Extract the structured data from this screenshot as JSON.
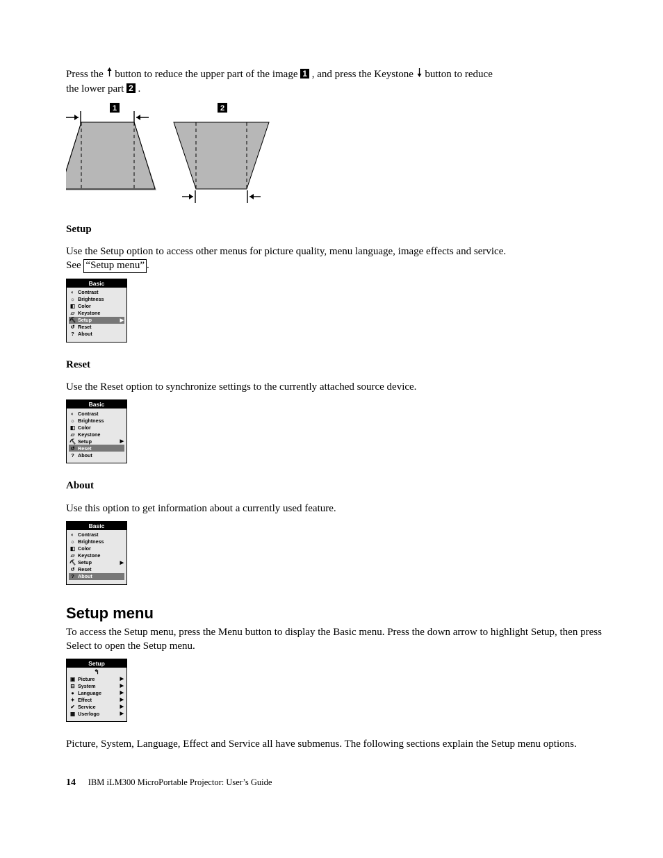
{
  "intro": {
    "line1a": "Press the ",
    "line1b": " button to reduce the upper part of the image ",
    "chip1": "1",
    "line1c": " , and press the Keystone ",
    "line1d": " button to reduce",
    "line2a": "the lower part ",
    "chip2": "2",
    "line2b": " ."
  },
  "diagram": {
    "chip1": "1",
    "chip2": "2"
  },
  "setup": {
    "heading": "Setup",
    "para_a": "Use the Setup option to access other menus for picture quality, menu language, image effects and service.",
    "para_b": "See ",
    "link": "“Setup menu”",
    "para_c": "."
  },
  "reset": {
    "heading": "Reset",
    "para": "Use the Reset option to synchronize settings to the currently attached source device."
  },
  "about": {
    "heading": "About",
    "para": "Use this option to get information about a currently used feature."
  },
  "setupmenu_section": {
    "heading": "Setup menu",
    "para1": "To access the Setup menu, press the Menu button to display the Basic menu. Press the down arrow to highlight Setup, then press Select to open the Setup menu.",
    "para2": "Picture, System, Language, Effect and Service all have submenus. The following sections explain the Setup menu options."
  },
  "basic_menu": {
    "title": "Basic",
    "items": [
      "Contrast",
      "Brightness",
      "Color",
      "Keystone",
      "Setup",
      "Reset",
      "About"
    ]
  },
  "setup_menu": {
    "title": "Setup",
    "items": [
      "Picture",
      "System",
      "Language",
      "Effect",
      "Service",
      "Userlogo"
    ]
  },
  "footer": {
    "pagenum": "14",
    "text": "IBM iLM300 MicroPortable Projector:  User’s Guide"
  }
}
